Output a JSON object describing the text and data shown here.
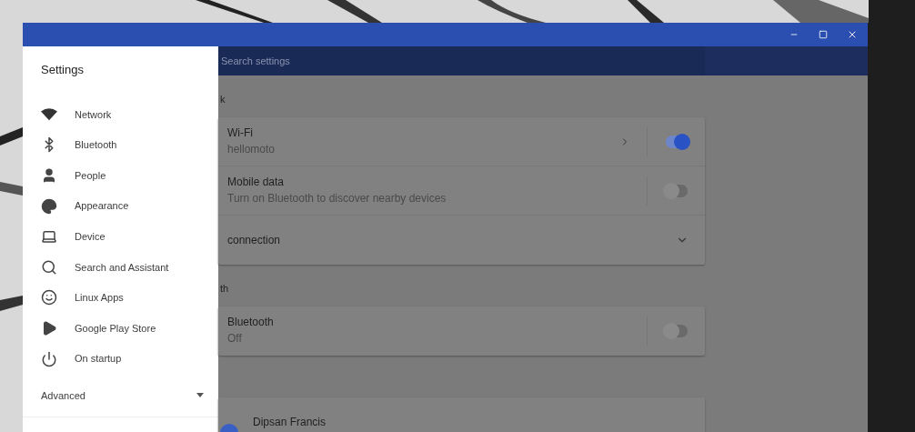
{
  "drawer": {
    "title": "Settings",
    "items": [
      {
        "label": "Network",
        "kind": "network"
      },
      {
        "label": "Bluetooth",
        "kind": "bluetooth"
      },
      {
        "label": "People",
        "kind": "people"
      },
      {
        "label": "Appearance",
        "kind": "appearance"
      },
      {
        "label": "Device",
        "kind": "device"
      },
      {
        "label": "Search and Assistant",
        "kind": "search"
      },
      {
        "label": "Linux Apps",
        "kind": "linux"
      },
      {
        "label": "Google Play Store",
        "kind": "play"
      },
      {
        "label": "On startup",
        "kind": "startup"
      }
    ],
    "advanced": {
      "label": "Advanced",
      "expanded": false
    }
  },
  "search": {
    "placeholder": "Search settings"
  },
  "sections": [
    {
      "heading": "k",
      "rows": [
        {
          "kind": "toggle",
          "title": "Wi-Fi",
          "subtitle": "hellomoto",
          "on": true,
          "link": true
        },
        {
          "kind": "toggle",
          "title": "Mobile data",
          "subtitle": "Turn on Bluetooth to discover nearby devices",
          "on": false
        },
        {
          "kind": "expand",
          "title": "connection",
          "expanded": false
        }
      ]
    },
    {
      "heading": "th",
      "rows": [
        {
          "kind": "toggle",
          "title": "Bluetooth",
          "subtitle": "Off",
          "on": false
        }
      ]
    },
    {
      "rows": [
        {
          "kind": "person",
          "title": "Dipsan Francis"
        }
      ]
    }
  ]
}
